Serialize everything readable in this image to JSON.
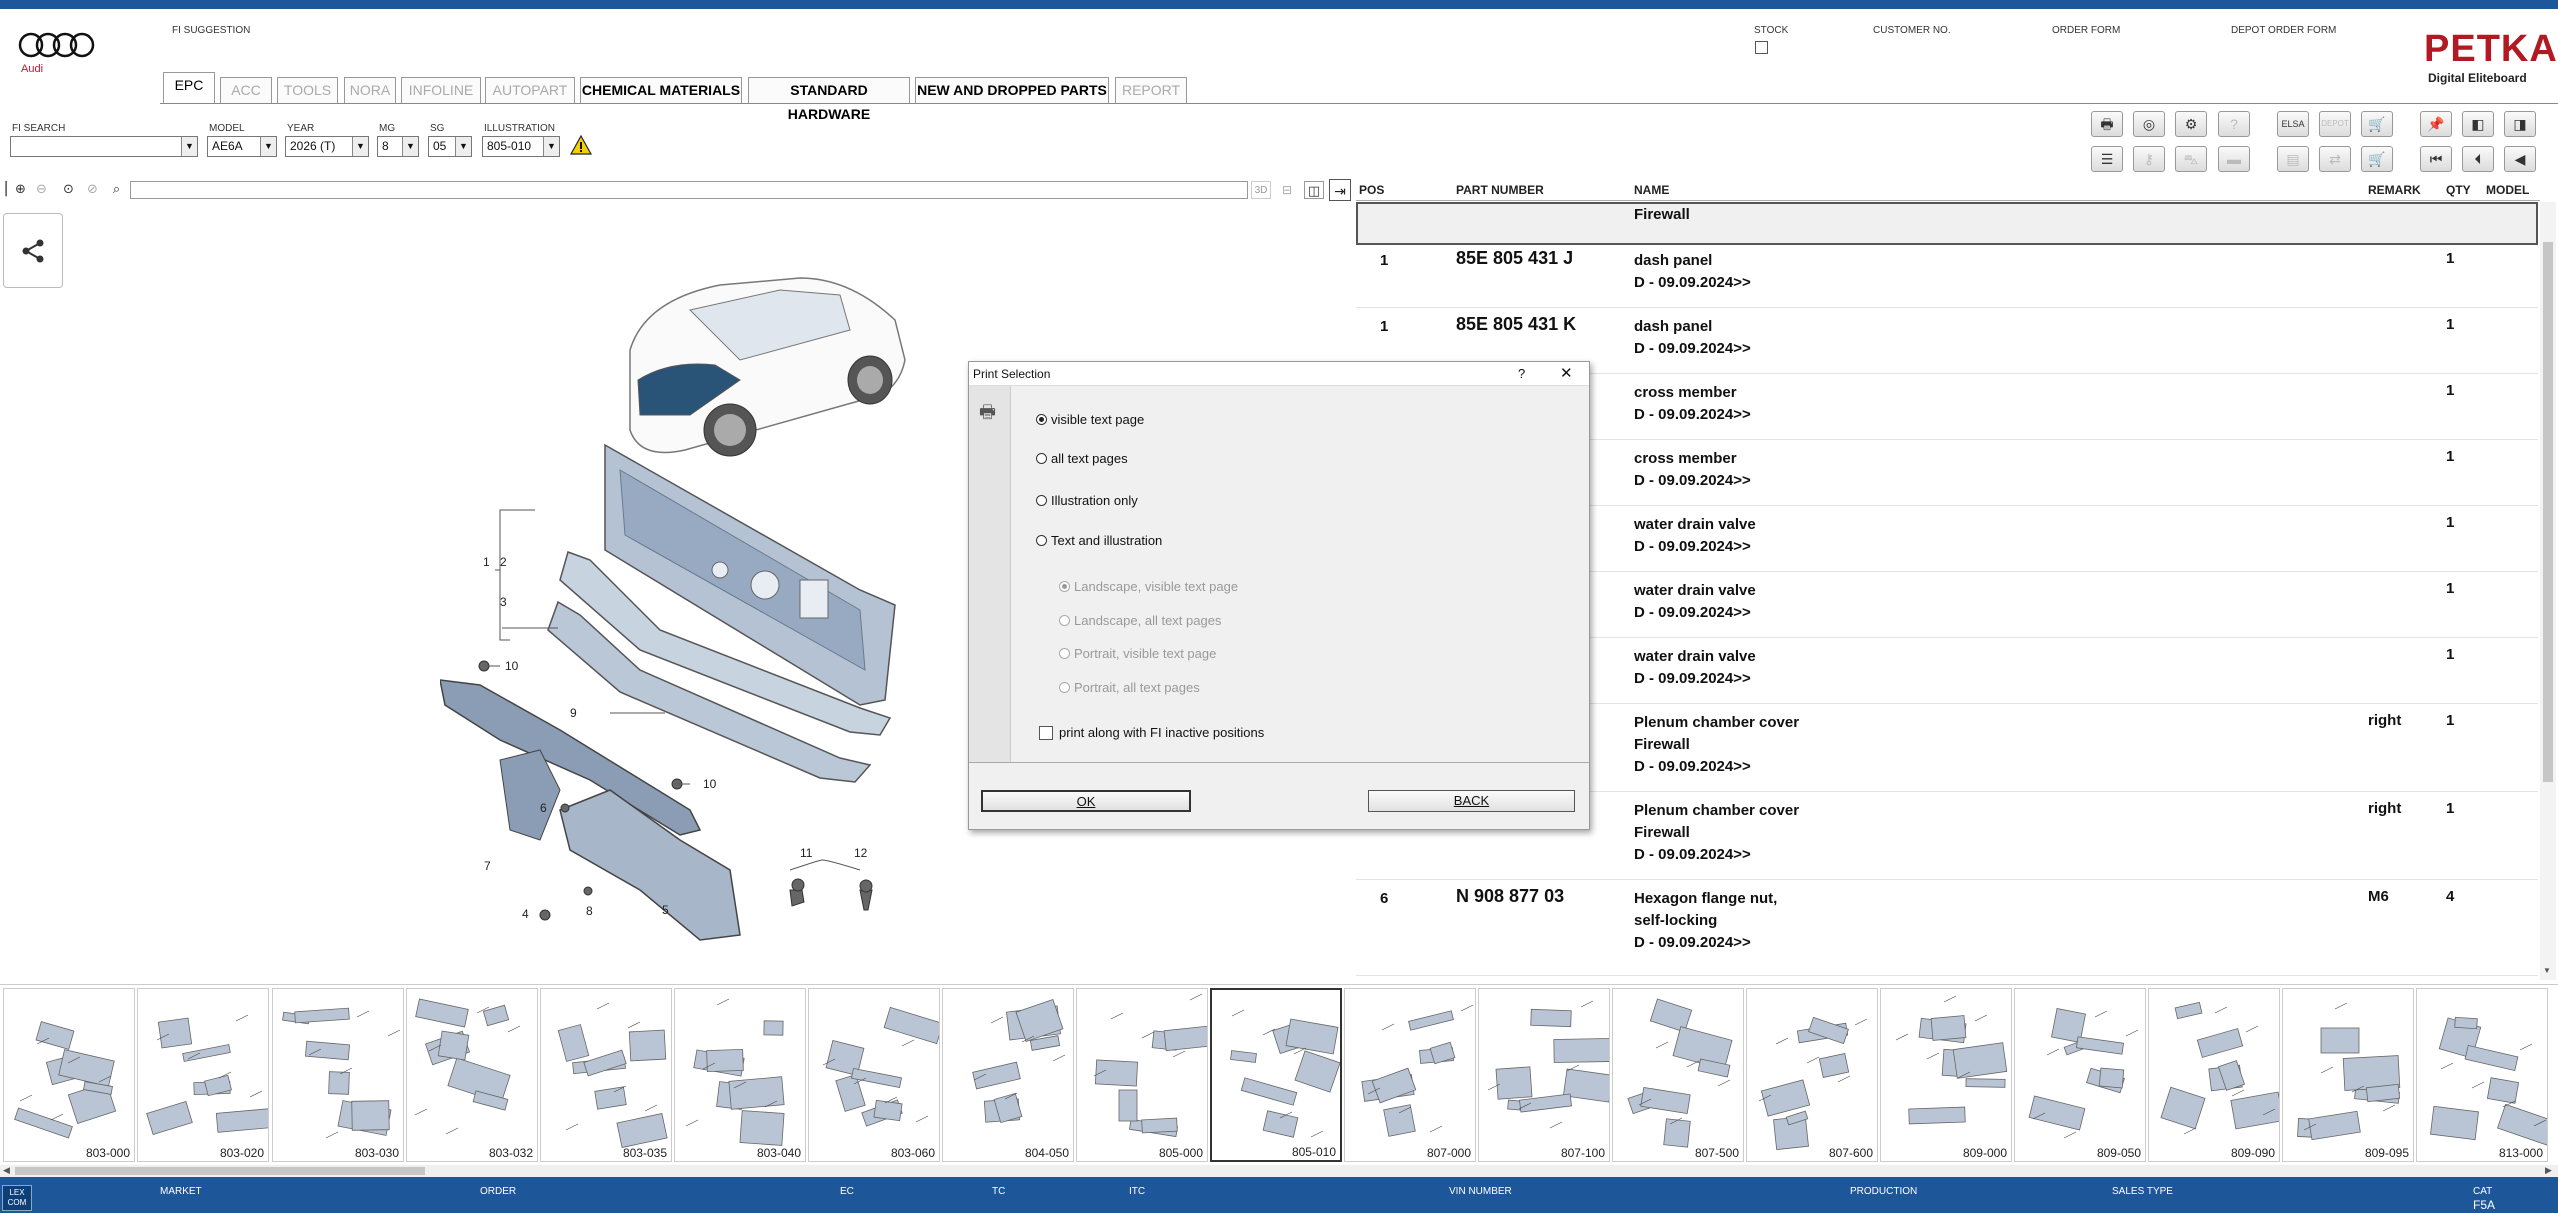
{
  "header": {
    "brand": "Audi",
    "fi_suggestion": "FI SUGGESTION",
    "stock": "STOCK",
    "customer_no": "CUSTOMER NO.",
    "order_form": "ORDER FORM",
    "depot_order_form": "DEPOT ORDER FORM",
    "petka_logo": "PETKA",
    "petka_sub": "Digital Eliteboard"
  },
  "tabs": [
    "EPC",
    "ACC",
    "TOOLS",
    "NORA",
    "INFOLINE",
    "AUTOPART",
    "CHEMICAL MATERIALS",
    "STANDARD HARDWARE",
    "NEW AND DROPPED PARTS",
    "REPORT"
  ],
  "filters": {
    "fi_search_label": "FI SEARCH",
    "fi_search_value": "",
    "model_label": "MODEL",
    "model_value": "AE6A",
    "year_label": "YEAR",
    "year_value": "2026 (T)",
    "mg_label": "MG",
    "mg_value": "8",
    "sg_label": "SG",
    "sg_value": "05",
    "illustration_label": "ILLUSTRATION",
    "illustration_value": "805-010"
  },
  "illustration_viewer": {
    "toggle_3d": "3D",
    "callouts": [
      "1",
      "2",
      "3",
      "10",
      "9",
      "10",
      "6",
      "7",
      "8",
      "4",
      "5",
      "11",
      "12"
    ]
  },
  "parts_table": {
    "headers": {
      "pos": "POS",
      "part_number": "PART NUMBER",
      "name": "NAME",
      "remark": "REMARK",
      "qty": "QTY",
      "model": "MODEL"
    },
    "group_title": "Firewall",
    "rows": [
      {
        "pos": "1",
        "part_number": "85E 805 431 J",
        "name": "dash panel",
        "line2": "D - 09.09.2024>>",
        "line3": "",
        "remark": "",
        "qty": "1"
      },
      {
        "pos": "1",
        "part_number": "85E 805 431 K",
        "name": "dash panel",
        "line2": "D - 09.09.2024>>",
        "line3": "",
        "remark": "",
        "qty": "1"
      },
      {
        "pos": "",
        "part_number": "",
        "name": "cross member",
        "line2": "D - 09.09.2024>>",
        "line3": "",
        "remark": "",
        "qty": "1"
      },
      {
        "pos": "",
        "part_number": "",
        "name": "cross member",
        "line2": "D - 09.09.2024>>",
        "line3": "",
        "remark": "",
        "qty": "1"
      },
      {
        "pos": "",
        "part_number": "",
        "name": "water drain valve",
        "line2": "D - 09.09.2024>>",
        "line3": "",
        "remark": "",
        "qty": "1"
      },
      {
        "pos": "",
        "part_number": "",
        "name": "water drain valve",
        "line2": "D - 09.09.2024>>",
        "line3": "",
        "remark": "",
        "qty": "1"
      },
      {
        "pos": "",
        "part_number": "",
        "name": "water drain valve",
        "line2": "D - 09.09.2024>>",
        "line3": "",
        "remark": "",
        "qty": "1"
      },
      {
        "pos": "",
        "part_number": "",
        "name": "Plenum chamber cover",
        "line2": "Firewall",
        "line3": "D - 09.09.2024>>",
        "remark": "right",
        "qty": "1"
      },
      {
        "pos": "",
        "part_number": "",
        "name": "Plenum chamber cover",
        "line2": "Firewall",
        "line3": "D - 09.09.2024>>",
        "remark": "right",
        "qty": "1"
      },
      {
        "pos": "6",
        "part_number": "N  908 877 03",
        "name": "Hexagon flange nut,",
        "line2": "self-locking",
        "line3": "D - 09.09.2024>>",
        "remark": "M6",
        "qty": "4"
      }
    ]
  },
  "thumbnails": [
    "803-000",
    "803-020",
    "803-030",
    "803-032",
    "803-035",
    "803-040",
    "803-060",
    "804-050",
    "805-000",
    "805-010",
    "807-000",
    "807-100",
    "807-500",
    "807-600",
    "809-000",
    "809-050",
    "809-090",
    "809-095",
    "813-000"
  ],
  "active_thumbnail": "805-010",
  "dialog": {
    "title": "Print Selection",
    "help": "?",
    "close": "✕",
    "options": [
      "visible text page",
      "all text pages",
      "Illustration only",
      "Text and illustration"
    ],
    "selected_option": "visible text page",
    "sub_options": [
      "Landscape, visible text page",
      "Landscape, all text pages",
      "Portrait, visible text page",
      "Portrait, all text pages"
    ],
    "fi_inactive_label": "print along with FI inactive positions",
    "ok": "OK",
    "back": "BACK"
  },
  "footer": {
    "market": "MARKET",
    "order": "ORDER",
    "ec": "EC",
    "tc": "TC",
    "itc": "ITC",
    "vin_number": "VIN NUMBER",
    "production": "PRODUCTION",
    "sales_type": "SALES TYPE",
    "cat": "CAT",
    "cat_value": "F5A",
    "lexcom": "LEX COM"
  },
  "colors": {
    "brand_blue": "#1d5699",
    "audi_red": "#c8102e",
    "petka_red": "#b01a22"
  }
}
